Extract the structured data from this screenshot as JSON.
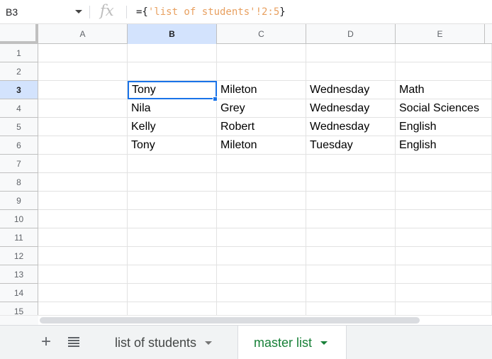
{
  "formula_bar": {
    "cell_reference": "B3",
    "fx_label": "fx",
    "formula_prefix": "={",
    "formula_ref": "'list of students'!2:5",
    "formula_suffix": "}"
  },
  "columns": [
    "A",
    "B",
    "C",
    "D",
    "E"
  ],
  "rows": [
    "1",
    "2",
    "3",
    "4",
    "5",
    "6",
    "7",
    "8",
    "9",
    "10",
    "11",
    "12",
    "13",
    "14",
    "15"
  ],
  "cells": {
    "r3": [
      "",
      "Tony",
      "Mileton",
      "Wednesday",
      "Math"
    ],
    "r4": [
      "",
      "Nila",
      "Grey",
      "Wednesday",
      "Social Sciences"
    ],
    "r5": [
      "",
      "Kelly",
      "Robert",
      "Wednesday",
      "English"
    ],
    "r6": [
      "",
      "Tony",
      "Mileton",
      "Tuesday",
      "English"
    ]
  },
  "active_cell": "B3",
  "sheet_tabs": [
    {
      "label": "list of students",
      "active": false
    },
    {
      "label": "master list",
      "active": true
    }
  ],
  "colors": {
    "accent": "#1a73e8",
    "active_tab": "#188038"
  }
}
